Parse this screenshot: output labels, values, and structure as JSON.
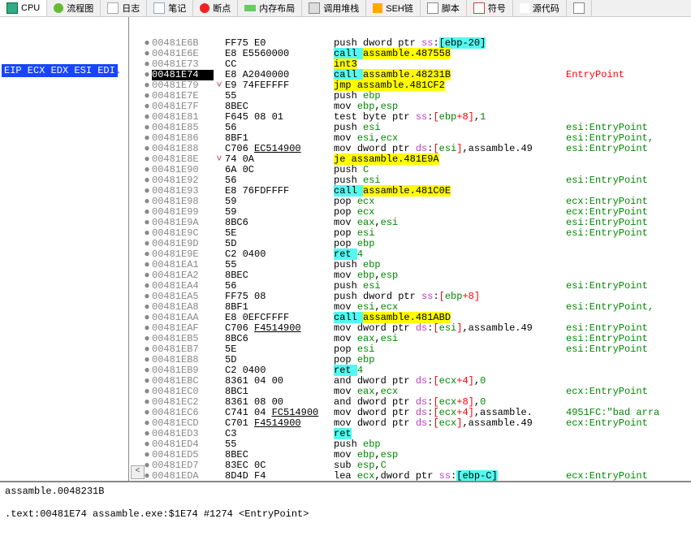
{
  "tabs": [
    {
      "label": "CPU",
      "icon": "cpu"
    },
    {
      "label": "流程图",
      "icon": "flow"
    },
    {
      "label": "日志",
      "icon": "log"
    },
    {
      "label": "笔记",
      "icon": "notes"
    },
    {
      "label": "断点",
      "icon": "bp"
    },
    {
      "label": "内存布局",
      "icon": "mem"
    },
    {
      "label": "调用堆栈",
      "icon": "stack"
    },
    {
      "label": "SEH链",
      "icon": "seh"
    },
    {
      "label": "脚本",
      "icon": "script"
    },
    {
      "label": "符号",
      "icon": "sym"
    },
    {
      "label": "源代码",
      "icon": "src"
    },
    {
      "label": "",
      "icon": "ref"
    }
  ],
  "registers_box": "EIP ECX EDX ESI EDI",
  "rows": [
    {
      "th": "●",
      "addr": "00481E6B",
      "bytes": "FF75 E0",
      "d": [
        {
          "t": "push"
        },
        {
          "t": " "
        },
        {
          "t": "dword ptr "
        },
        {
          "t": "ss",
          "c": "seg"
        },
        {
          "t": ":"
        },
        {
          "t": "[",
          "c": "hl-cyan"
        },
        {
          "t": "ebp",
          "c": "hl-cyan"
        },
        {
          "t": "-",
          "c": "hl-cyan"
        },
        {
          "t": "20",
          "c": "hl-cyan"
        },
        {
          "t": "]",
          "c": "hl-cyan"
        }
      ],
      "cmt": ""
    },
    {
      "th": "●",
      "addr": "00481E6E",
      "bytes": "E8 E5560000",
      "d": [
        {
          "t": "call ",
          "c": "hl-cyan"
        },
        {
          "t": "assamble.487558",
          "c": "hl-yellow"
        }
      ],
      "cmt": ""
    },
    {
      "th": "●",
      "addr": "00481E73",
      "bytes": "CC",
      "d": [
        {
          "t": "int3",
          "c": "hl-yellow"
        }
      ],
      "cmt": ""
    },
    {
      "current": true,
      "th": "●",
      "addr": "00481E74",
      "bytes": "E8 A2040000",
      "d": [
        {
          "t": "call ",
          "c": "hl-cyan"
        },
        {
          "t": "assamble.48231B",
          "c": "hl-yellow"
        }
      ],
      "cmt": "EntryPoint",
      "cmtc": "lbl"
    },
    {
      "th": "●",
      "exp": "˅",
      "addr": "00481E79",
      "bytes": "E9 74FEFFFF",
      "d": [
        {
          "t": "jmp ",
          "c": "hl-yellow"
        },
        {
          "t": "assamble.481CF2",
          "c": "hl-yellow"
        }
      ],
      "cmt": ""
    },
    {
      "th": "●",
      "addr": "00481E7E",
      "bytes": "55",
      "d": [
        {
          "t": "push "
        },
        {
          "t": "ebp",
          "c": "reg"
        }
      ],
      "cmt": ""
    },
    {
      "th": "●",
      "addr": "00481E7F",
      "bytes": "8BEC",
      "d": [
        {
          "t": "mov "
        },
        {
          "t": "ebp",
          "c": "reg"
        },
        {
          "t": ","
        },
        {
          "t": "esp",
          "c": "reg"
        }
      ],
      "cmt": ""
    },
    {
      "th": "●",
      "addr": "00481E81",
      "bytes": "F645 08 01",
      "d": [
        {
          "t": "test "
        },
        {
          "t": "byte ptr "
        },
        {
          "t": "ss",
          "c": "seg"
        },
        {
          "t": ":"
        },
        {
          "t": "[",
          "c": "br-open"
        },
        {
          "t": "ebp",
          "c": "reg"
        },
        {
          "t": "+",
          "c": "red"
        },
        {
          "t": "8",
          "c": "red"
        },
        {
          "t": "]",
          "c": "br-close"
        },
        {
          "t": ","
        },
        {
          "t": "1",
          "c": "num"
        }
      ],
      "cmt": ""
    },
    {
      "th": "●",
      "addr": "00481E85",
      "bytes": "56",
      "d": [
        {
          "t": "push "
        },
        {
          "t": "esi",
          "c": "reg"
        }
      ],
      "cmt": "esi:EntryPoint",
      "cmtc": "ep"
    },
    {
      "th": "●",
      "addr": "00481E86",
      "bytes": "8BF1",
      "d": [
        {
          "t": "mov "
        },
        {
          "t": "esi",
          "c": "reg"
        },
        {
          "t": ","
        },
        {
          "t": "ecx",
          "c": "reg"
        }
      ],
      "cmt": "esi:EntryPoint,",
      "cmtc": "ep"
    },
    {
      "th": "●",
      "addr": "00481E88",
      "bytes": "C706 ",
      "bytes2": "EC514900",
      "d": [
        {
          "t": "mov "
        },
        {
          "t": "dword ptr "
        },
        {
          "t": "ds",
          "c": "seg"
        },
        {
          "t": ":"
        },
        {
          "t": "[",
          "c": "br-open"
        },
        {
          "t": "esi",
          "c": "reg"
        },
        {
          "t": "]",
          "c": "br-close"
        },
        {
          "t": ",assamble.49"
        }
      ],
      "cmt": "esi:EntryPoint",
      "cmtc": "ep"
    },
    {
      "th": "●",
      "exp": "˅",
      "addr": "00481E8E",
      "bytes": "74 0A",
      "d": [
        {
          "t": "je ",
          "c": "hl-yellow"
        },
        {
          "t": "assamble.481E9A",
          "c": "hl-yellow"
        }
      ],
      "cmt": ""
    },
    {
      "th": "●",
      "addr": "00481E90",
      "bytes": "6A 0C",
      "d": [
        {
          "t": "push "
        },
        {
          "t": "C",
          "c": "num"
        }
      ],
      "cmt": ""
    },
    {
      "th": "●",
      "addr": "00481E92",
      "bytes": "56",
      "d": [
        {
          "t": "push "
        },
        {
          "t": "esi",
          "c": "reg"
        }
      ],
      "cmt": "esi:EntryPoint",
      "cmtc": "ep"
    },
    {
      "th": "●",
      "addr": "00481E93",
      "bytes": "E8 76FDFFFF",
      "d": [
        {
          "t": "call ",
          "c": "hl-cyan"
        },
        {
          "t": "assamble.481C0E",
          "c": "hl-yellow"
        }
      ],
      "cmt": ""
    },
    {
      "th": "●",
      "addr": "00481E98",
      "bytes": "59",
      "d": [
        {
          "t": "pop "
        },
        {
          "t": "ecx",
          "c": "reg"
        }
      ],
      "cmt": "ecx:EntryPoint",
      "cmtc": "ep"
    },
    {
      "th": "●",
      "addr": "00481E99",
      "bytes": "59",
      "d": [
        {
          "t": "pop "
        },
        {
          "t": "ecx",
          "c": "reg"
        }
      ],
      "cmt": "ecx:EntryPoint",
      "cmtc": "ep"
    },
    {
      "th": "●",
      "addr": "00481E9A",
      "bytes": "8BC6",
      "d": [
        {
          "t": "mov "
        },
        {
          "t": "eax",
          "c": "reg"
        },
        {
          "t": ","
        },
        {
          "t": "esi",
          "c": "reg"
        }
      ],
      "cmt": "esi:EntryPoint",
      "cmtc": "ep"
    },
    {
      "th": "●",
      "addr": "00481E9C",
      "bytes": "5E",
      "d": [
        {
          "t": "pop "
        },
        {
          "t": "esi",
          "c": "reg"
        }
      ],
      "cmt": "esi:EntryPoint",
      "cmtc": "ep"
    },
    {
      "th": "●",
      "addr": "00481E9D",
      "bytes": "5D",
      "d": [
        {
          "t": "pop "
        },
        {
          "t": "ebp",
          "c": "reg"
        }
      ],
      "cmt": ""
    },
    {
      "th": "●",
      "addr": "00481E9E",
      "bytes": "C2 0400",
      "d": [
        {
          "t": "ret ",
          "c": "hl-cyan"
        },
        {
          "t": "4",
          "c": "num"
        }
      ],
      "cmt": ""
    },
    {
      "th": "●",
      "addr": "00481EA1",
      "bytes": "55",
      "d": [
        {
          "t": "push "
        },
        {
          "t": "ebp",
          "c": "reg"
        }
      ],
      "cmt": ""
    },
    {
      "th": "●",
      "addr": "00481EA2",
      "bytes": "8BEC",
      "d": [
        {
          "t": "mov "
        },
        {
          "t": "ebp",
          "c": "reg"
        },
        {
          "t": ","
        },
        {
          "t": "esp",
          "c": "reg"
        }
      ],
      "cmt": ""
    },
    {
      "th": "●",
      "addr": "00481EA4",
      "bytes": "56",
      "d": [
        {
          "t": "push "
        },
        {
          "t": "esi",
          "c": "reg"
        }
      ],
      "cmt": "esi:EntryPoint",
      "cmtc": "ep"
    },
    {
      "th": "●",
      "addr": "00481EA5",
      "bytes": "FF75 08",
      "d": [
        {
          "t": "push "
        },
        {
          "t": "dword ptr "
        },
        {
          "t": "ss",
          "c": "seg"
        },
        {
          "t": ":"
        },
        {
          "t": "[",
          "c": "br-open"
        },
        {
          "t": "ebp",
          "c": "reg"
        },
        {
          "t": "+",
          "c": "red"
        },
        {
          "t": "8",
          "c": "red"
        },
        {
          "t": "]",
          "c": "br-close"
        }
      ],
      "cmt": ""
    },
    {
      "th": "●",
      "addr": "00481EA8",
      "bytes": "8BF1",
      "d": [
        {
          "t": "mov "
        },
        {
          "t": "esi",
          "c": "reg"
        },
        {
          "t": ","
        },
        {
          "t": "ecx",
          "c": "reg"
        }
      ],
      "cmt": "esi:EntryPoint,",
      "cmtc": "ep"
    },
    {
      "th": "●",
      "addr": "00481EAA",
      "bytes": "E8 0EFCFFFF",
      "d": [
        {
          "t": "call ",
          "c": "hl-cyan"
        },
        {
          "t": "assamble.481ABD",
          "c": "hl-yellow"
        }
      ],
      "cmt": ""
    },
    {
      "th": "●",
      "addr": "00481EAF",
      "bytes": "C706 ",
      "bytes2": "F4514900",
      "d": [
        {
          "t": "mov "
        },
        {
          "t": "dword ptr "
        },
        {
          "t": "ds",
          "c": "seg"
        },
        {
          "t": ":"
        },
        {
          "t": "[",
          "c": "br-open"
        },
        {
          "t": "esi",
          "c": "reg"
        },
        {
          "t": "]",
          "c": "br-close"
        },
        {
          "t": ",assamble.49"
        }
      ],
      "cmt": "esi:EntryPoint",
      "cmtc": "ep"
    },
    {
      "th": "●",
      "addr": "00481EB5",
      "bytes": "8BC6",
      "d": [
        {
          "t": "mov "
        },
        {
          "t": "eax",
          "c": "reg"
        },
        {
          "t": ","
        },
        {
          "t": "esi",
          "c": "reg"
        }
      ],
      "cmt": "esi:EntryPoint",
      "cmtc": "ep"
    },
    {
      "th": "●",
      "addr": "00481EB7",
      "bytes": "5E",
      "d": [
        {
          "t": "pop "
        },
        {
          "t": "esi",
          "c": "reg"
        }
      ],
      "cmt": "esi:EntryPoint",
      "cmtc": "ep"
    },
    {
      "th": "●",
      "addr": "00481EB8",
      "bytes": "5D",
      "d": [
        {
          "t": "pop "
        },
        {
          "t": "ebp",
          "c": "reg"
        }
      ],
      "cmt": ""
    },
    {
      "th": "●",
      "addr": "00481EB9",
      "bytes": "C2 0400",
      "d": [
        {
          "t": "ret ",
          "c": "hl-cyan"
        },
        {
          "t": "4",
          "c": "num"
        }
      ],
      "cmt": ""
    },
    {
      "th": "●",
      "addr": "00481EBC",
      "bytes": "8361 04 00",
      "d": [
        {
          "t": "and "
        },
        {
          "t": "dword ptr "
        },
        {
          "t": "ds",
          "c": "seg"
        },
        {
          "t": ":"
        },
        {
          "t": "[",
          "c": "br-open"
        },
        {
          "t": "ecx",
          "c": "reg"
        },
        {
          "t": "+",
          "c": "red"
        },
        {
          "t": "4",
          "c": "red"
        },
        {
          "t": "]",
          "c": "br-close"
        },
        {
          "t": ","
        },
        {
          "t": "0",
          "c": "num"
        }
      ],
      "cmt": ""
    },
    {
      "th": "●",
      "addr": "00481EC0",
      "bytes": "8BC1",
      "d": [
        {
          "t": "mov "
        },
        {
          "t": "eax",
          "c": "reg"
        },
        {
          "t": ","
        },
        {
          "t": "ecx",
          "c": "reg"
        }
      ],
      "cmt": "ecx:EntryPoint",
      "cmtc": "ep"
    },
    {
      "th": "●",
      "addr": "00481EC2",
      "bytes": "8361 08 00",
      "d": [
        {
          "t": "and "
        },
        {
          "t": "dword ptr "
        },
        {
          "t": "ds",
          "c": "seg"
        },
        {
          "t": ":"
        },
        {
          "t": "[",
          "c": "br-open"
        },
        {
          "t": "ecx",
          "c": "reg"
        },
        {
          "t": "+",
          "c": "red"
        },
        {
          "t": "8",
          "c": "red"
        },
        {
          "t": "]",
          "c": "br-close"
        },
        {
          "t": ","
        },
        {
          "t": "0",
          "c": "num"
        }
      ],
      "cmt": ""
    },
    {
      "th": "●",
      "addr": "00481EC6",
      "bytes": "C741 04 ",
      "bytes2": "FC514900",
      "d": [
        {
          "t": "mov "
        },
        {
          "t": "dword ptr "
        },
        {
          "t": "ds",
          "c": "seg"
        },
        {
          "t": ":"
        },
        {
          "t": "[",
          "c": "br-open"
        },
        {
          "t": "ecx",
          "c": "reg"
        },
        {
          "t": "+",
          "c": "red"
        },
        {
          "t": "4",
          "c": "red"
        },
        {
          "t": "]",
          "c": "br-close"
        },
        {
          "t": ",assamble."
        }
      ],
      "cmt": "4951FC:\"bad arra",
      "cmtc": "ep"
    },
    {
      "th": "●",
      "addr": "00481ECD",
      "bytes": "C701 ",
      "bytes2": "F4514900",
      "d": [
        {
          "t": "mov "
        },
        {
          "t": "dword ptr "
        },
        {
          "t": "ds",
          "c": "seg"
        },
        {
          "t": ":"
        },
        {
          "t": "[",
          "c": "br-open"
        },
        {
          "t": "ecx",
          "c": "reg"
        },
        {
          "t": "]",
          "c": "br-close"
        },
        {
          "t": ",assamble.49"
        }
      ],
      "cmt": "ecx:EntryPoint",
      "cmtc": "ep"
    },
    {
      "th": "●",
      "addr": "00481ED3",
      "bytes": "C3",
      "d": [
        {
          "t": "ret",
          "c": "hl-cyan"
        }
      ],
      "cmt": ""
    },
    {
      "th": "●",
      "addr": "00481ED4",
      "bytes": "55",
      "d": [
        {
          "t": "push "
        },
        {
          "t": "ebp",
          "c": "reg"
        }
      ],
      "cmt": ""
    },
    {
      "th": "●",
      "addr": "00481ED5",
      "bytes": "8BEC",
      "d": [
        {
          "t": "mov "
        },
        {
          "t": "ebp",
          "c": "reg"
        },
        {
          "t": ","
        },
        {
          "t": "esp",
          "c": "reg"
        }
      ],
      "cmt": ""
    },
    {
      "th": "●",
      "addr": "00481ED7",
      "bytes": "83EC 0C",
      "d": [
        {
          "t": "sub "
        },
        {
          "t": "esp",
          "c": "reg"
        },
        {
          "t": ","
        },
        {
          "t": "C",
          "c": "num"
        }
      ],
      "cmt": ""
    },
    {
      "th": "●",
      "addr": "00481EDA",
      "bytes": "8D4D F4",
      "d": [
        {
          "t": "lea "
        },
        {
          "t": "ecx",
          "c": "reg"
        },
        {
          "t": ","
        },
        {
          "t": "dword ptr "
        },
        {
          "t": "ss",
          "c": "seg"
        },
        {
          "t": ":"
        },
        {
          "t": "[",
          "c": "hl-cyan"
        },
        {
          "t": "ebp",
          "c": "hl-cyan"
        },
        {
          "t": "-",
          "c": "hl-cyan"
        },
        {
          "t": "C",
          "c": "hl-cyan"
        },
        {
          "t": "]",
          "c": "hl-cyan"
        }
      ],
      "cmt": "ecx:EntryPoint",
      "cmtc": "ep"
    }
  ],
  "bottom": {
    "line1": "assamble.0048231B",
    "line2": ".text:00481E74 assamble.exe:$1E74 #1274 <EntryPoint>"
  }
}
